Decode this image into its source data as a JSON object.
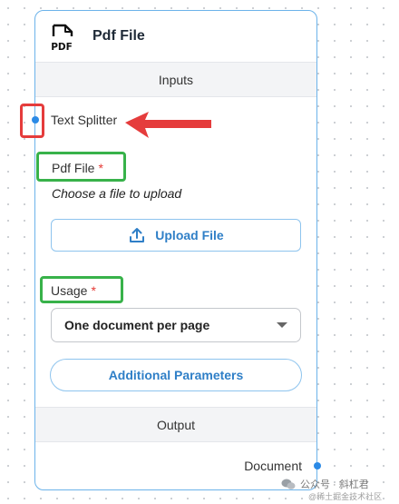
{
  "node": {
    "title": "Pdf File",
    "icon_text": "PDF",
    "inputs_section": "Inputs",
    "output_section": "Output",
    "text_splitter_label": "Text Splitter",
    "pdf_file_label": "Pdf File",
    "required_mark": "*",
    "pdf_file_hint": "Choose a file to upload",
    "upload_button": "Upload File",
    "usage_label": "Usage",
    "usage_value": "One document per page",
    "additional_params_button": "Additional Parameters",
    "output_label": "Document"
  },
  "watermark": {
    "text": "公众号 · 斜杠君",
    "subtext": "@稀土掘金技术社区"
  },
  "colors": {
    "accent": "#2f7fc7",
    "node_border": "#6cb3ea",
    "handle": "#2b8ae6",
    "annotation_red": "#e53c3c",
    "annotation_green": "#38b24a",
    "required": "#e53935"
  }
}
